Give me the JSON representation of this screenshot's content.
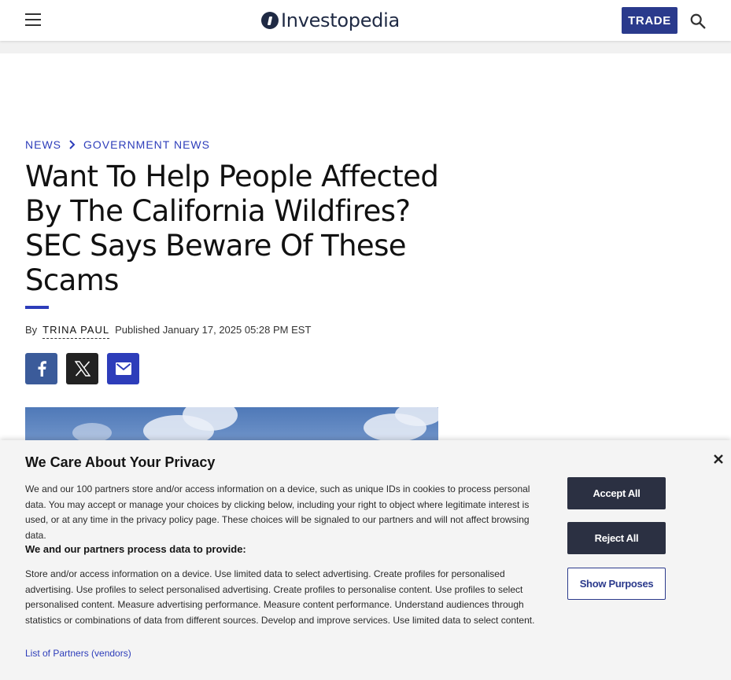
{
  "header": {
    "logo_text": "Investopedia",
    "trade_label": "TRADE"
  },
  "breadcrumb": {
    "items": [
      "NEWS",
      "GOVERNMENT NEWS"
    ]
  },
  "article": {
    "title": "Want To Help People Affected By The California Wildfires? SEC Says Beware Of These Scams",
    "by_label": "By",
    "author": "TRINA PAUL",
    "published": "Published January 17, 2025 05:28 PM EST"
  },
  "share": {
    "icons": [
      "facebook-icon",
      "x-icon",
      "email-icon"
    ]
  },
  "privacy": {
    "heading": "We Care About Your Privacy",
    "body": "We and our 100 partners store and/or access information on a device, such as unique IDs in cookies to process personal data. You may accept or manage your choices by clicking below, including your right to object where legitimate interest is used, or at any time in the privacy policy page. These choices will be signaled to our partners and will not affect browsing data.",
    "subheading": "We and our partners process data to provide:",
    "purposes": "Store and/or access information on a device. Use limited data to select advertising. Create profiles for personalised advertising. Use profiles to select personalised advertising. Create profiles to personalise content. Use profiles to select personalised content. Measure advertising performance. Measure content performance. Understand audiences through statistics or combinations of data from different sources. Develop and improve services. Use limited data to select content.",
    "partners_link": "List of Partners (vendors)",
    "accept_label": "Accept All",
    "reject_label": "Reject All",
    "purposes_label": "Show Purposes"
  },
  "colors": {
    "brand_navy": "#1f2a44",
    "trade_blue": "#2a3a8c",
    "link_blue": "#2d3dba",
    "button_dark": "#2b3042"
  }
}
